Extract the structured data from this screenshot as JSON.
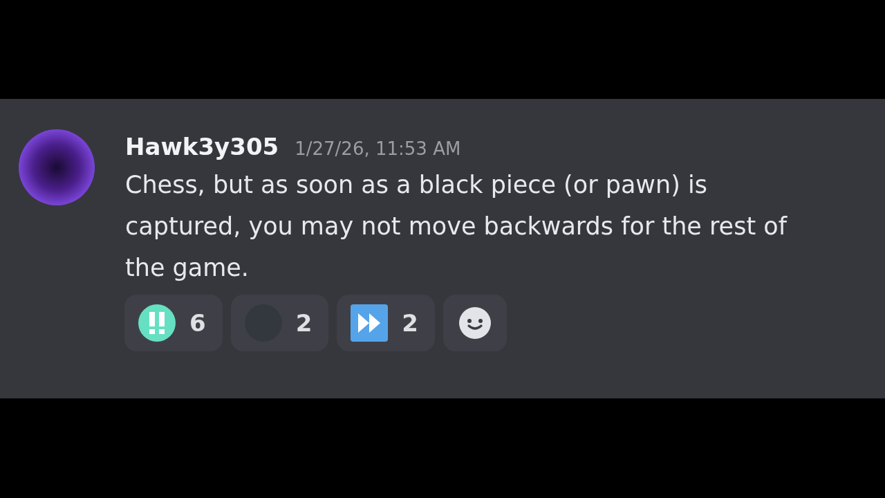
{
  "message": {
    "author": "Hawk3y305",
    "timestamp": "1/27/26, 11:53 AM",
    "text": "Chess, but as soon as a black piece (or pawn) is captured, you may not move backwards for the rest of the game."
  },
  "reactions": [
    {
      "count": "6",
      "selected": false
    },
    {
      "count": "2",
      "selected": false
    },
    {
      "count": "2",
      "selected": false
    }
  ]
}
